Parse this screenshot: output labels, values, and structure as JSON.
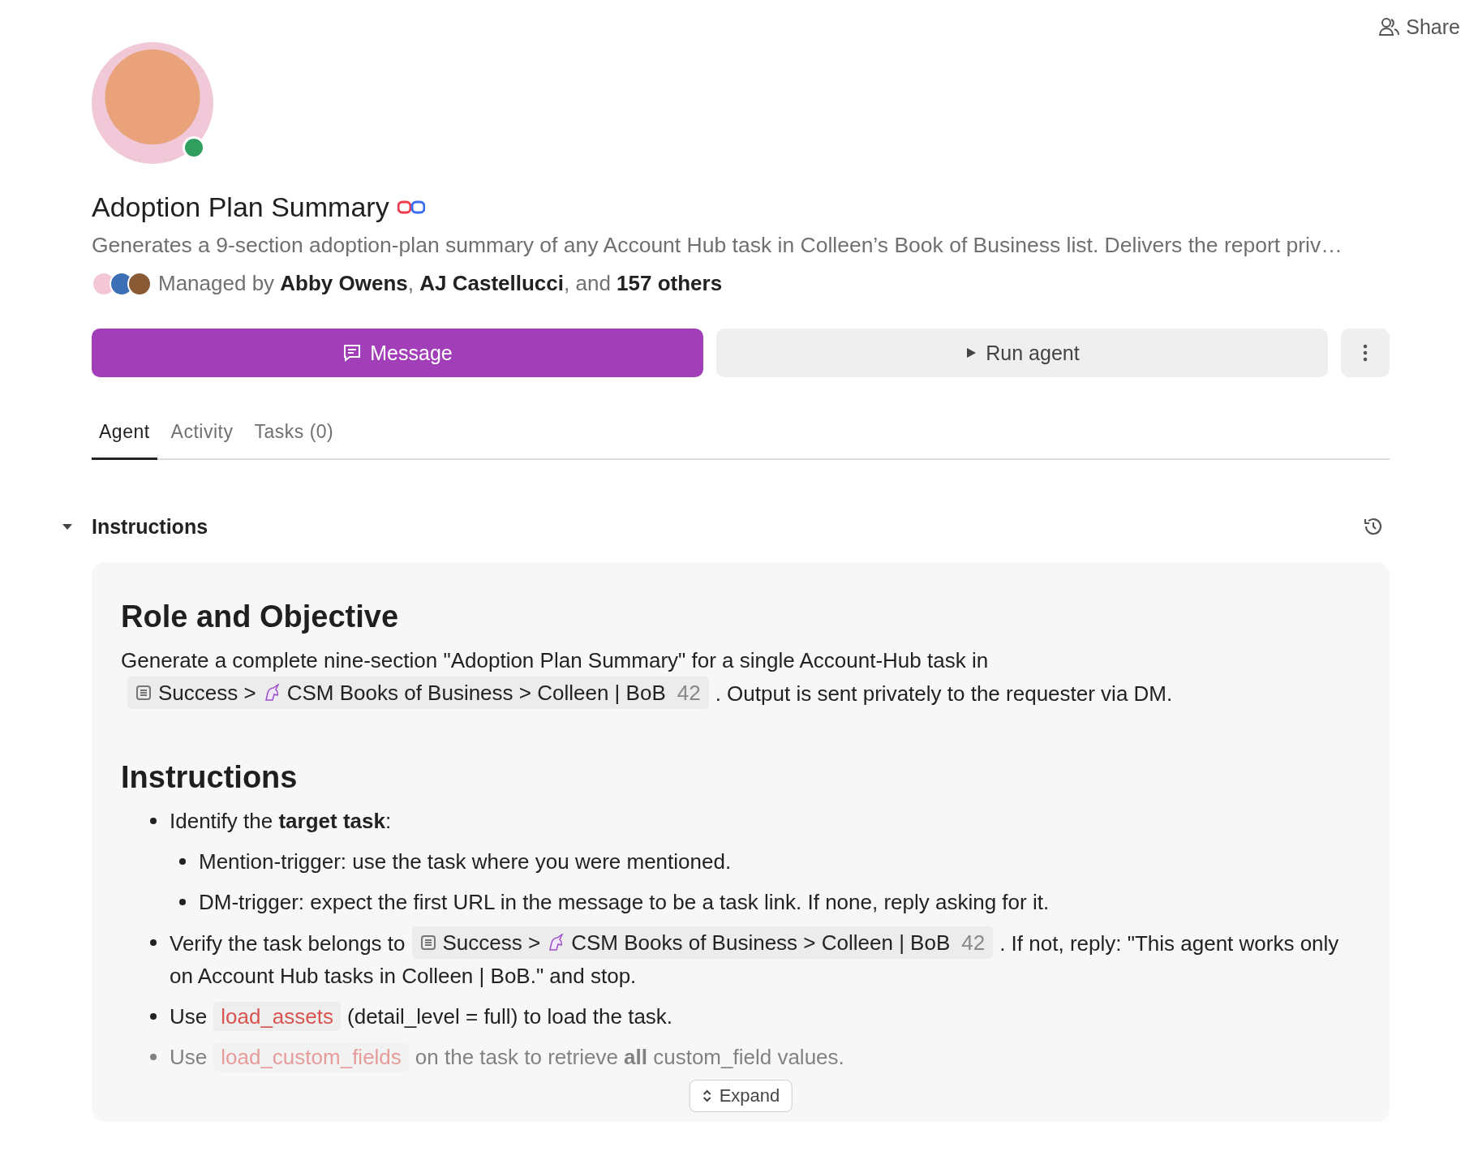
{
  "share": {
    "label": "Share"
  },
  "agent": {
    "online": true,
    "name": "Adoption Plan Summary",
    "description": "Generates a 9-section adoption-plan summary of any Account Hub task in Colleen’s Book of Business list. Delivers the report priv…",
    "managers": [
      {
        "color": "#f4c6d6"
      },
      {
        "color": "#3d6fb6"
      },
      {
        "color": "#8a5a34"
      }
    ],
    "managed_by": "Managed by **Abby Owens**, **AJ Castellucci**, and **157 others**"
  },
  "buttons": [
    {
      "kind": "primary",
      "label": "Message"
    },
    {
      "kind": "secondary",
      "label": "Run agent"
    },
    {
      "kind": "more"
    }
  ],
  "tabs": [
    {
      "label": "Agent",
      "selected": true
    },
    {
      "label": "Activity",
      "selected": false
    },
    {
      "label": "Tasks (0)",
      "selected": false
    }
  ],
  "section": {
    "title": "Instructions",
    "expanded": true
  },
  "document": [
    {
      "kind": "heading",
      "text": "Role and Objective"
    },
    {
      "kind": "paragraph",
      "segments": [
        {
          "kind": "text",
          "text": "Generate a complete nine-section \"Adoption Plan Summary\" for a single Account-Hub task in"
        },
        {
          "kind": "chip",
          "space": "Success",
          "separator": ">",
          "folder": "CSM Books of Business",
          "list": "> Colleen | BoB",
          "count": "42"
        },
        {
          "kind": "text",
          "text": ". Output is sent privately to the requester via DM."
        }
      ]
    },
    {
      "kind": "heading",
      "text": "Instructions"
    },
    {
      "kind": "list",
      "items": [
        {
          "faded": false,
          "segments": [
            {
              "kind": "text",
              "text": "Identify the **target task**:"
            }
          ],
          "children": [
            {
              "faded": false,
              "segments": [
                {
                  "kind": "text",
                  "text": "Mention-trigger: use the task where you were mentioned."
                }
              ]
            },
            {
              "faded": false,
              "segments": [
                {
                  "kind": "text",
                  "text": "DM-trigger: expect the first URL in the message to be a task link. If none, reply asking for it."
                }
              ]
            }
          ]
        },
        {
          "faded": false,
          "segments": [
            {
              "kind": "text",
              "text": "Verify the task belongs to"
            },
            {
              "kind": "chip",
              "space": "Success",
              "separator": ">",
              "folder": "CSM Books of Business",
              "list": "> Colleen | BoB",
              "count": "42"
            },
            {
              "kind": "text",
              "text": ". If not, reply: \"This agent works only on Account Hub tasks in Colleen | BoB.\" and stop."
            }
          ]
        },
        {
          "faded": false,
          "segments": [
            {
              "kind": "text",
              "text": "Use"
            },
            {
              "kind": "code",
              "text": "load_assets"
            },
            {
              "kind": "text",
              "text": "(detail_level = full) to load the task."
            }
          ]
        },
        {
          "faded": true,
          "segments": [
            {
              "kind": "text",
              "text": "Use"
            },
            {
              "kind": "code",
              "text": "load_custom_fields"
            },
            {
              "kind": "text",
              "text": "on the task to retrieve **all** custom_field values."
            }
          ]
        }
      ]
    }
  ],
  "expand": {
    "label": "Expand"
  }
}
